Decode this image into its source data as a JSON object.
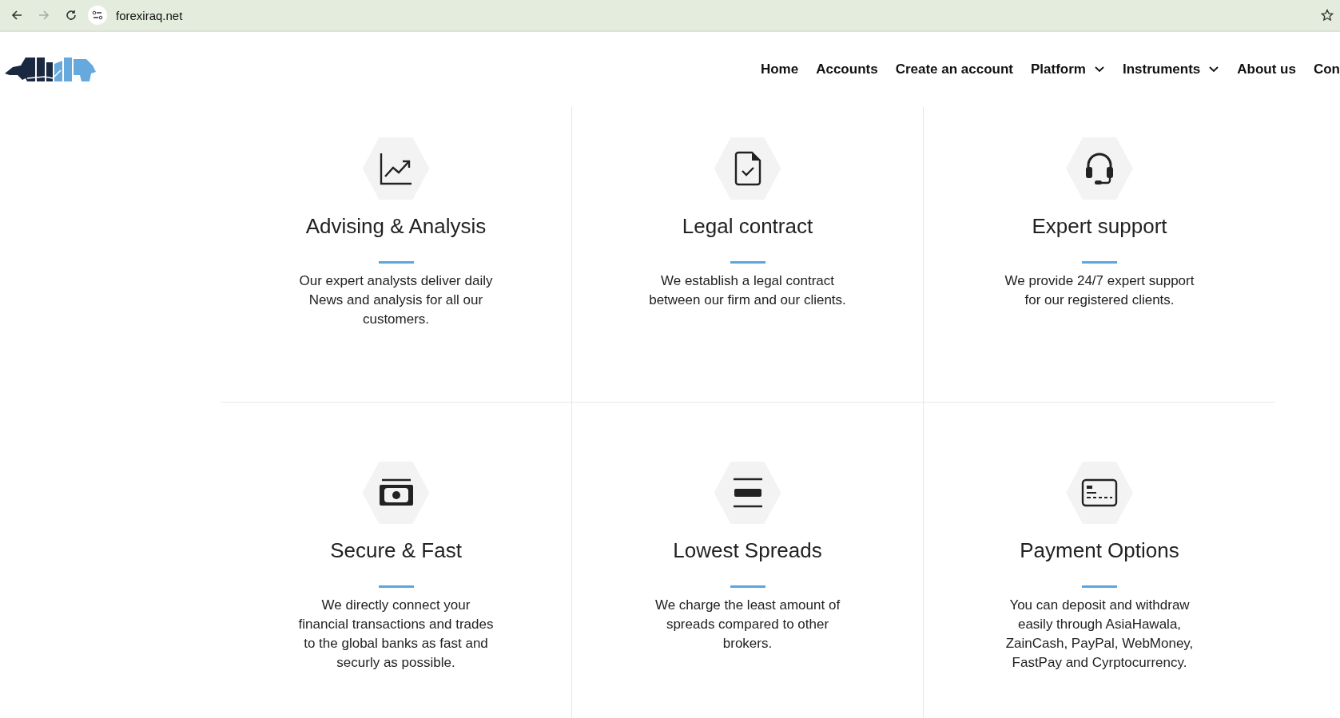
{
  "browser": {
    "url": "forexiraq.net",
    "forward_disabled": true
  },
  "nav": [
    {
      "label": "Home",
      "dropdown": false
    },
    {
      "label": "Accounts",
      "dropdown": false
    },
    {
      "label": "Create an account",
      "dropdown": false
    },
    {
      "label": "Platform",
      "dropdown": true
    },
    {
      "label": "Instruments",
      "dropdown": true
    },
    {
      "label": "About us",
      "dropdown": false
    },
    {
      "label": "Con",
      "dropdown": false
    }
  ],
  "features": [
    {
      "kind": "chart",
      "title": "Advising & Analysis",
      "text": "Our expert analysts deliver daily News and analysis for all our customers."
    },
    {
      "kind": "document",
      "title": "Legal contract",
      "text": "We establish a legal contract between our firm and our clients."
    },
    {
      "kind": "headset",
      "title": "Expert support",
      "text": "We provide 24/7 expert support for our registered clients."
    },
    {
      "kind": "cash",
      "title": "Secure & Fast",
      "text": "We directly connect your financial transactions and trades to the global banks as fast and securly as possible."
    },
    {
      "kind": "spread",
      "title": "Lowest Spreads",
      "text": "We charge the least amount of spreads compared to other brokers."
    },
    {
      "kind": "card",
      "title": "Payment Options",
      "text": "You can deposit and withdraw easily through AsiaHawala, ZainCash, PayPal, WebMoney, FastPay and Cyrptocurrency."
    }
  ]
}
